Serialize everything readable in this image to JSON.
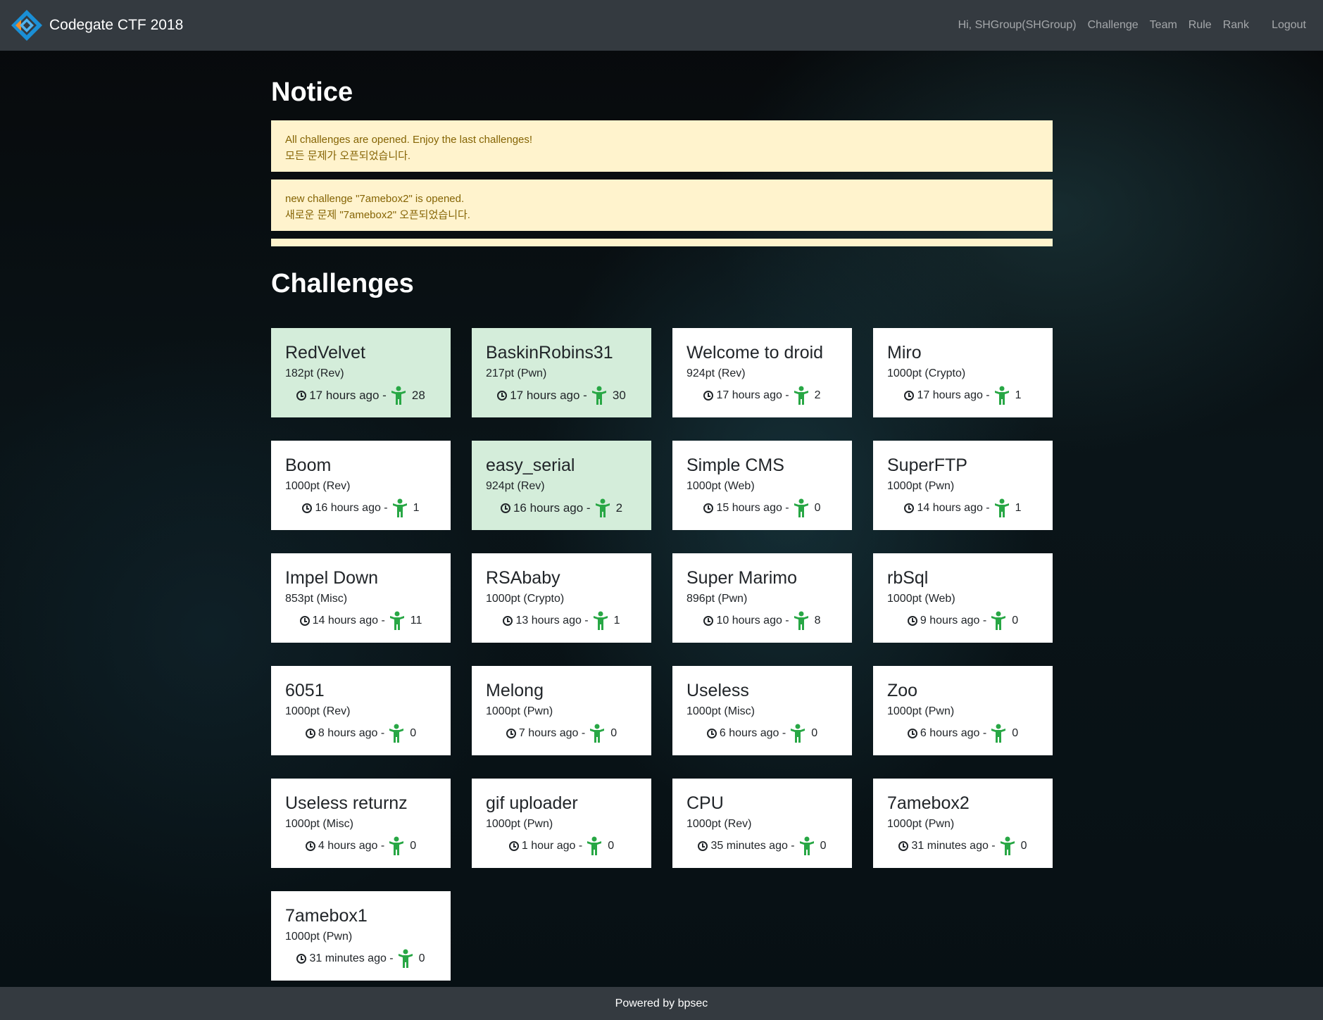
{
  "navbar": {
    "brand": "Codegate CTF 2018",
    "greeting": "Hi, SHGroup(SHGroup)",
    "links": [
      "Challenge",
      "Team",
      "Rule",
      "Rank"
    ],
    "logout": "Logout"
  },
  "notice": {
    "title": "Notice",
    "items": [
      {
        "line1": "All challenges are opened. Enjoy the last challenges!",
        "line2": "모든 문제가 오픈되었습니다."
      },
      {
        "line1": "new challenge \"7amebox2\" is opened.",
        "line2": "새로운 문제 \"7amebox2\" 오픈되었습니다."
      }
    ]
  },
  "challenges": {
    "title": "Challenges",
    "items": [
      {
        "name": "RedVelvet",
        "points": "182pt (Rev)",
        "time": "17 hours ago -",
        "solves": "28",
        "solved": true
      },
      {
        "name": "BaskinRobins31",
        "points": "217pt (Pwn)",
        "time": "17 hours ago -",
        "solves": "30",
        "solved": true
      },
      {
        "name": "Welcome to droid",
        "points": "924pt (Rev)",
        "time": "17 hours ago -",
        "solves": "2",
        "solved": false
      },
      {
        "name": "Miro",
        "points": "1000pt (Crypto)",
        "time": "17 hours ago -",
        "solves": "1",
        "solved": false
      },
      {
        "name": "Boom",
        "points": "1000pt (Rev)",
        "time": "16 hours ago -",
        "solves": "1",
        "solved": false
      },
      {
        "name": "easy_serial",
        "points": "924pt (Rev)",
        "time": "16 hours ago -",
        "solves": "2",
        "solved": true
      },
      {
        "name": "Simple CMS",
        "points": "1000pt (Web)",
        "time": "15 hours ago -",
        "solves": "0",
        "solved": false
      },
      {
        "name": "SuperFTP",
        "points": "1000pt (Pwn)",
        "time": "14 hours ago -",
        "solves": "1",
        "solved": false
      },
      {
        "name": "Impel Down",
        "points": "853pt (Misc)",
        "time": "14 hours ago -",
        "solves": "11",
        "solved": false
      },
      {
        "name": "RSAbaby",
        "points": "1000pt (Crypto)",
        "time": "13 hours ago -",
        "solves": "1",
        "solved": false
      },
      {
        "name": "Super Marimo",
        "points": "896pt (Pwn)",
        "time": "10 hours ago -",
        "solves": "8",
        "solved": false
      },
      {
        "name": "rbSql",
        "points": "1000pt (Web)",
        "time": "9 hours ago -",
        "solves": "0",
        "solved": false
      },
      {
        "name": "6051",
        "points": "1000pt (Rev)",
        "time": "8 hours ago -",
        "solves": "0",
        "solved": false
      },
      {
        "name": "Melong",
        "points": "1000pt (Pwn)",
        "time": "7 hours ago -",
        "solves": "0",
        "solved": false
      },
      {
        "name": "Useless",
        "points": "1000pt (Misc)",
        "time": "6 hours ago -",
        "solves": "0",
        "solved": false
      },
      {
        "name": "Zoo",
        "points": "1000pt (Pwn)",
        "time": "6 hours ago -",
        "solves": "0",
        "solved": false
      },
      {
        "name": "Useless returnz",
        "points": "1000pt (Misc)",
        "time": "4 hours ago -",
        "solves": "0",
        "solved": false
      },
      {
        "name": "gif uploader",
        "points": "1000pt (Pwn)",
        "time": "1 hour ago -",
        "solves": "0",
        "solved": false
      },
      {
        "name": "CPU",
        "points": "1000pt (Rev)",
        "time": "35 minutes ago -",
        "solves": "0",
        "solved": false
      },
      {
        "name": "7amebox2",
        "points": "1000pt (Pwn)",
        "time": "31 minutes ago -",
        "solves": "0",
        "solved": false
      },
      {
        "name": "7amebox1",
        "points": "1000pt (Pwn)",
        "time": "31 minutes ago -",
        "solves": "0",
        "solved": false
      }
    ]
  },
  "footer": {
    "text": "Powered by bpsec"
  },
  "colors": {
    "navbar": "#343a40",
    "notice_bg": "#fff3cd",
    "notice_text": "#856404",
    "solved_card": "#d4edda",
    "person_icon": "#28a745"
  },
  "icons": {
    "clock": "clock-icon",
    "solver": "person-icon",
    "logo": "codegate-logo-icon"
  }
}
